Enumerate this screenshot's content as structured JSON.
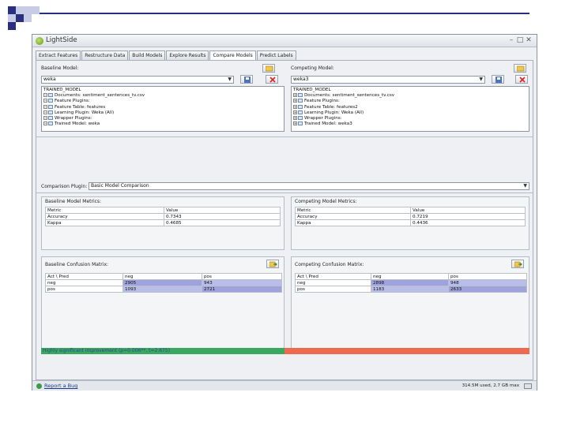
{
  "window": {
    "title": "LightSide",
    "controls": [
      "minimize-icon",
      "maximize-icon",
      "close-icon"
    ]
  },
  "tabs": [
    {
      "label": "Extract Features"
    },
    {
      "label": "Restructure Data"
    },
    {
      "label": "Build Models"
    },
    {
      "label": "Explore Results"
    },
    {
      "label": "Compare Models",
      "active": true
    },
    {
      "label": "Predict Labels"
    }
  ],
  "baseline": {
    "header": "Baseline Model:",
    "model_select": "weka",
    "tree": [
      {
        "text": "TRAINED_MODEL",
        "level": 0
      },
      {
        "text": "Documents: sentiment_sentences_tv.csv",
        "level": 1
      },
      {
        "text": "Feature Plugins:",
        "level": 1
      },
      {
        "text": "Feature Table: features",
        "level": 1
      },
      {
        "text": "Learning Plugin:  Weka (All)",
        "level": 1
      },
      {
        "text": "Wrapper Plugins:",
        "level": 1
      },
      {
        "text": "Trained Model: weka",
        "level": 1
      }
    ],
    "metrics_title": "Baseline Model Metrics:",
    "metrics_headers": [
      "Metric",
      "Value"
    ],
    "metrics_rows": [
      [
        "Accuracy",
        "0.7343"
      ],
      [
        "Kappa",
        "0.4685"
      ]
    ],
    "confusion_title": "Baseline Confusion Matrix:",
    "confusion_headers": [
      "Act \\ Pred",
      "neg",
      "pos"
    ],
    "confusion_rows": [
      [
        "neg",
        "2905",
        "943"
      ],
      [
        "pos",
        "1093",
        "2721"
      ]
    ]
  },
  "competing": {
    "header": "Competing Model:",
    "model_select": "weka3",
    "tree": [
      {
        "text": "TRAINED_MODEL",
        "level": 0
      },
      {
        "text": "Documents: sentiment_sentences_tv.csv",
        "level": 1
      },
      {
        "text": "Feature Plugins:",
        "level": 1
      },
      {
        "text": "Feature Table: features2",
        "level": 1
      },
      {
        "text": "Learning Plugin:  Weka (All)",
        "level": 1
      },
      {
        "text": "Wrapper Plugins:",
        "level": 1
      },
      {
        "text": "Trained Model: weka3",
        "level": 1
      }
    ],
    "metrics_title": "Competing Model Metrics:",
    "metrics_headers": [
      "Metric",
      "Value"
    ],
    "metrics_rows": [
      [
        "Accuracy",
        "0.7219"
      ],
      [
        "Kappa",
        "0.4436"
      ]
    ],
    "confusion_title": "Competing Confusion Matrix:",
    "confusion_headers": [
      "Act \\ Pred",
      "neg",
      "pos"
    ],
    "confusion_rows": [
      [
        "neg",
        "2898",
        "948"
      ],
      [
        "pos",
        "1183",
        "2633"
      ]
    ]
  },
  "comparison": {
    "label": "Comparison Plugin:",
    "plugin": "Basic Model Comparison",
    "result_text": "Highly significant improvement (p=0.006**, t=2.675)"
  },
  "colors": {
    "significance_win": "#3aa860",
    "significance_loss": "#ec6b50",
    "matrix_highlight": "#b9bde9"
  },
  "status": {
    "report_bug": "Report a Bug",
    "memory": "314.5M used, 2.7 GB max"
  }
}
